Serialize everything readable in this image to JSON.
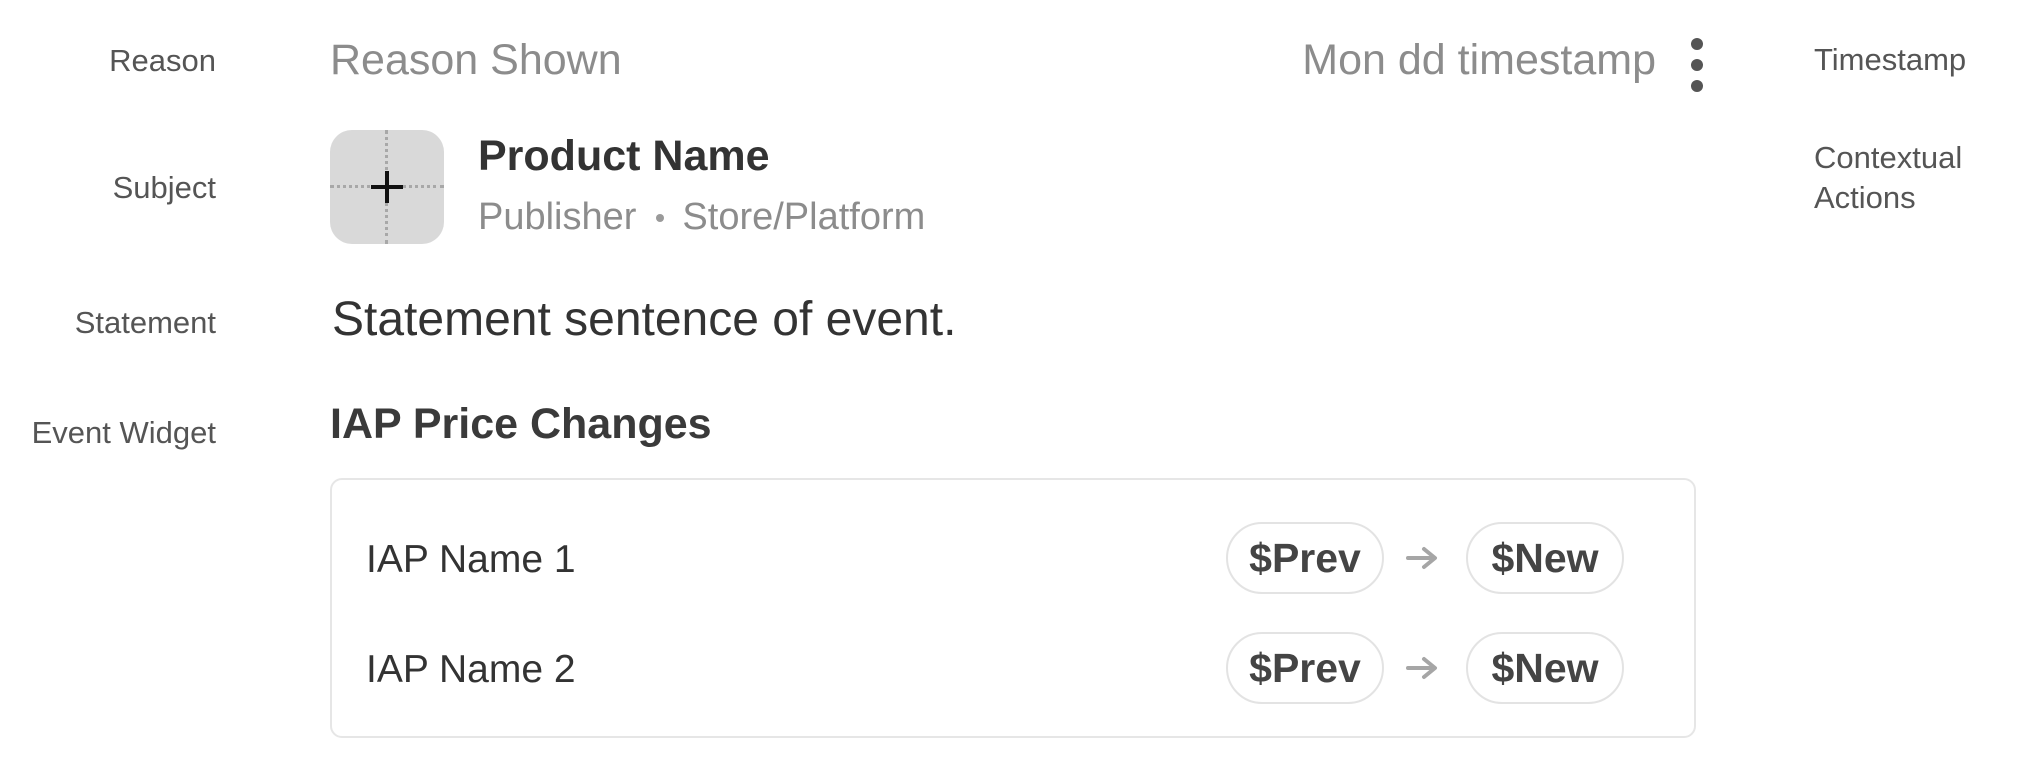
{
  "annotations": {
    "reason": "Reason",
    "subject": "Subject",
    "statement": "Statement",
    "event_widget": "Event Widget",
    "timestamp": "Timestamp",
    "contextual_actions_line1": "Contextual",
    "contextual_actions_line2": "Actions"
  },
  "header": {
    "reason_shown": "Reason Shown",
    "timestamp": "Mon dd timestamp",
    "more_icon": "more-vert-icon"
  },
  "subject": {
    "icon": "app-placeholder-icon",
    "product_name": "Product Name",
    "publisher": "Publisher",
    "platform": "Store/Platform"
  },
  "statement": "Statement sentence of event.",
  "widget": {
    "title": "IAP Price Changes",
    "rows": [
      {
        "name": "IAP Name 1",
        "prev": "$Prev",
        "new": "$New"
      },
      {
        "name": "IAP Name 2",
        "prev": "$Prev",
        "new": "$New"
      }
    ],
    "arrow_icon": "arrow-right-icon"
  },
  "colors": {
    "muted_text": "#8c8c8c",
    "primary_text": "#333333",
    "icon_bg": "#d9d9d9",
    "border": "#e6e6e6"
  }
}
